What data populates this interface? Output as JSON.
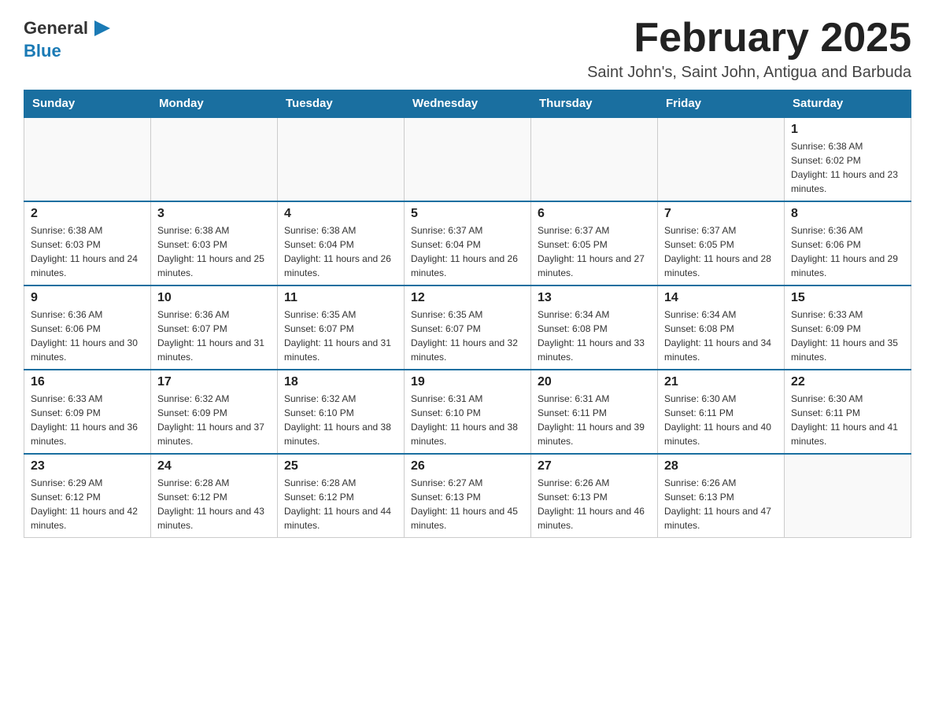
{
  "logo": {
    "text_general": "General",
    "text_blue": "Blue"
  },
  "header": {
    "title": "February 2025",
    "subtitle": "Saint John's, Saint John, Antigua and Barbuda"
  },
  "weekdays": [
    "Sunday",
    "Monday",
    "Tuesday",
    "Wednesday",
    "Thursday",
    "Friday",
    "Saturday"
  ],
  "weeks": [
    [
      {
        "day": "",
        "info": ""
      },
      {
        "day": "",
        "info": ""
      },
      {
        "day": "",
        "info": ""
      },
      {
        "day": "",
        "info": ""
      },
      {
        "day": "",
        "info": ""
      },
      {
        "day": "",
        "info": ""
      },
      {
        "day": "1",
        "info": "Sunrise: 6:38 AM\nSunset: 6:02 PM\nDaylight: 11 hours and 23 minutes."
      }
    ],
    [
      {
        "day": "2",
        "info": "Sunrise: 6:38 AM\nSunset: 6:03 PM\nDaylight: 11 hours and 24 minutes."
      },
      {
        "day": "3",
        "info": "Sunrise: 6:38 AM\nSunset: 6:03 PM\nDaylight: 11 hours and 25 minutes."
      },
      {
        "day": "4",
        "info": "Sunrise: 6:38 AM\nSunset: 6:04 PM\nDaylight: 11 hours and 26 minutes."
      },
      {
        "day": "5",
        "info": "Sunrise: 6:37 AM\nSunset: 6:04 PM\nDaylight: 11 hours and 26 minutes."
      },
      {
        "day": "6",
        "info": "Sunrise: 6:37 AM\nSunset: 6:05 PM\nDaylight: 11 hours and 27 minutes."
      },
      {
        "day": "7",
        "info": "Sunrise: 6:37 AM\nSunset: 6:05 PM\nDaylight: 11 hours and 28 minutes."
      },
      {
        "day": "8",
        "info": "Sunrise: 6:36 AM\nSunset: 6:06 PM\nDaylight: 11 hours and 29 minutes."
      }
    ],
    [
      {
        "day": "9",
        "info": "Sunrise: 6:36 AM\nSunset: 6:06 PM\nDaylight: 11 hours and 30 minutes."
      },
      {
        "day": "10",
        "info": "Sunrise: 6:36 AM\nSunset: 6:07 PM\nDaylight: 11 hours and 31 minutes."
      },
      {
        "day": "11",
        "info": "Sunrise: 6:35 AM\nSunset: 6:07 PM\nDaylight: 11 hours and 31 minutes."
      },
      {
        "day": "12",
        "info": "Sunrise: 6:35 AM\nSunset: 6:07 PM\nDaylight: 11 hours and 32 minutes."
      },
      {
        "day": "13",
        "info": "Sunrise: 6:34 AM\nSunset: 6:08 PM\nDaylight: 11 hours and 33 minutes."
      },
      {
        "day": "14",
        "info": "Sunrise: 6:34 AM\nSunset: 6:08 PM\nDaylight: 11 hours and 34 minutes."
      },
      {
        "day": "15",
        "info": "Sunrise: 6:33 AM\nSunset: 6:09 PM\nDaylight: 11 hours and 35 minutes."
      }
    ],
    [
      {
        "day": "16",
        "info": "Sunrise: 6:33 AM\nSunset: 6:09 PM\nDaylight: 11 hours and 36 minutes."
      },
      {
        "day": "17",
        "info": "Sunrise: 6:32 AM\nSunset: 6:09 PM\nDaylight: 11 hours and 37 minutes."
      },
      {
        "day": "18",
        "info": "Sunrise: 6:32 AM\nSunset: 6:10 PM\nDaylight: 11 hours and 38 minutes."
      },
      {
        "day": "19",
        "info": "Sunrise: 6:31 AM\nSunset: 6:10 PM\nDaylight: 11 hours and 38 minutes."
      },
      {
        "day": "20",
        "info": "Sunrise: 6:31 AM\nSunset: 6:11 PM\nDaylight: 11 hours and 39 minutes."
      },
      {
        "day": "21",
        "info": "Sunrise: 6:30 AM\nSunset: 6:11 PM\nDaylight: 11 hours and 40 minutes."
      },
      {
        "day": "22",
        "info": "Sunrise: 6:30 AM\nSunset: 6:11 PM\nDaylight: 11 hours and 41 minutes."
      }
    ],
    [
      {
        "day": "23",
        "info": "Sunrise: 6:29 AM\nSunset: 6:12 PM\nDaylight: 11 hours and 42 minutes."
      },
      {
        "day": "24",
        "info": "Sunrise: 6:28 AM\nSunset: 6:12 PM\nDaylight: 11 hours and 43 minutes."
      },
      {
        "day": "25",
        "info": "Sunrise: 6:28 AM\nSunset: 6:12 PM\nDaylight: 11 hours and 44 minutes."
      },
      {
        "day": "26",
        "info": "Sunrise: 6:27 AM\nSunset: 6:13 PM\nDaylight: 11 hours and 45 minutes."
      },
      {
        "day": "27",
        "info": "Sunrise: 6:26 AM\nSunset: 6:13 PM\nDaylight: 11 hours and 46 minutes."
      },
      {
        "day": "28",
        "info": "Sunrise: 6:26 AM\nSunset: 6:13 PM\nDaylight: 11 hours and 47 minutes."
      },
      {
        "day": "",
        "info": ""
      }
    ]
  ]
}
